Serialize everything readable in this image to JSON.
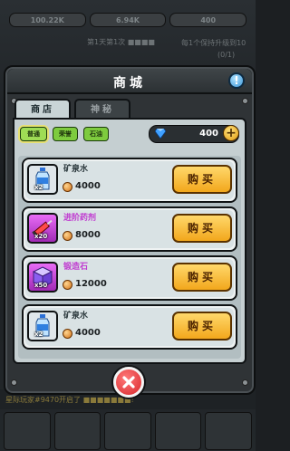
{
  "background": {
    "resources": [
      "100.22K",
      "6.94K",
      "400"
    ],
    "notice": "第1天第1次 ■■■■",
    "quest": "每1个保持升级到10",
    "quest_progress": "(0/1)",
    "chat": "星际玩家#9470开启了 ■■■■■■■!"
  },
  "modal": {
    "title": "商城",
    "info_symbol": "!",
    "tabs": [
      {
        "label": "商店",
        "active": true
      },
      {
        "label": "神秘",
        "active": false
      }
    ],
    "filters": [
      "普通",
      "荣誉",
      "石油"
    ],
    "gems": "400",
    "items": [
      {
        "name": "矿泉水",
        "count": "x2",
        "price": "4000",
        "buy": "购买",
        "name_color": "#2d3a3e",
        "icon": "water-bottle-icon"
      },
      {
        "name": "进阶药剂",
        "count": "x20",
        "price": "8000",
        "buy": "购买",
        "name_color": "#c03bd0",
        "icon": "syringe-icon"
      },
      {
        "name": "锻造石",
        "count": "x50",
        "price": "12000",
        "buy": "购买",
        "name_color": "#c03bd0",
        "icon": "forge-cube-icon"
      },
      {
        "name": "矿泉水",
        "count": "x2",
        "price": "4000",
        "buy": "购买",
        "name_color": "#2d3a3e",
        "icon": "water-bottle-icon"
      }
    ]
  },
  "colors": {
    "accent_buy": "#f2a71c",
    "filter_green": "#7ecb3e",
    "purple_rarity": "#c03bd0",
    "close_red": "#d8262a"
  }
}
